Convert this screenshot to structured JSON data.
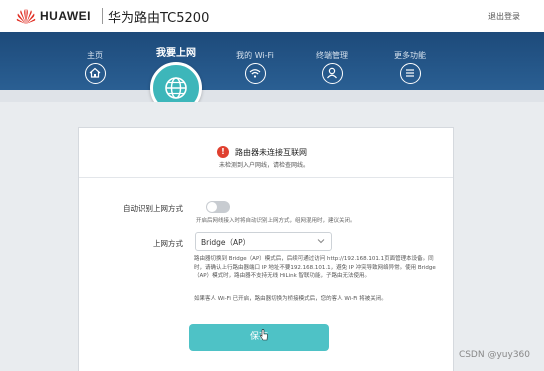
{
  "header": {
    "brand": "HUAWEI",
    "product": "华为路由TC5200",
    "logout": "退出登录"
  },
  "nav": {
    "items": [
      {
        "label": "主页",
        "icon": "home-icon"
      },
      {
        "label": "我要上网",
        "icon": "globe-icon",
        "active": true
      },
      {
        "label": "我的 Wi-Fi",
        "icon": "wifi-icon"
      },
      {
        "label": "终端管理",
        "icon": "user-icon"
      },
      {
        "label": "更多功能",
        "icon": "menu-icon"
      }
    ]
  },
  "alert": {
    "title": "路由器未连接互联网",
    "subtitle": "未检测到入户网线，请检查网线。"
  },
  "auto_detect": {
    "label": "自动识别上网方式",
    "enabled": false,
    "hint": "开启后网线接入时将自动识别上网方式，组网混用时，建议关闭。"
  },
  "access_mode": {
    "label": "上网方式",
    "value": "Bridge（AP）",
    "description": "路由器切换到 Bridge（AP）模式后，后续可通过访问 http://192.168.101.1页面管理本设备。同时，请确认上行路由器端口 IP 地址不要192.168.101.1，避免 IP 冲突导致网络异常。使用 Bridge（AP）模式时，路由器不支持无线 HiLink 智联功能，子路由无法使用。",
    "note": "如果客人 Wi-Fi 已开启，路由器切换为桥接模式后，您的客人 Wi-Fi 将被关闭。"
  },
  "save_button": "保存",
  "watermark": "CSDN @yuy360",
  "colors": {
    "nav_bg": "#1f4e7f",
    "accent": "#3db6ba",
    "alert": "#e0402f"
  }
}
